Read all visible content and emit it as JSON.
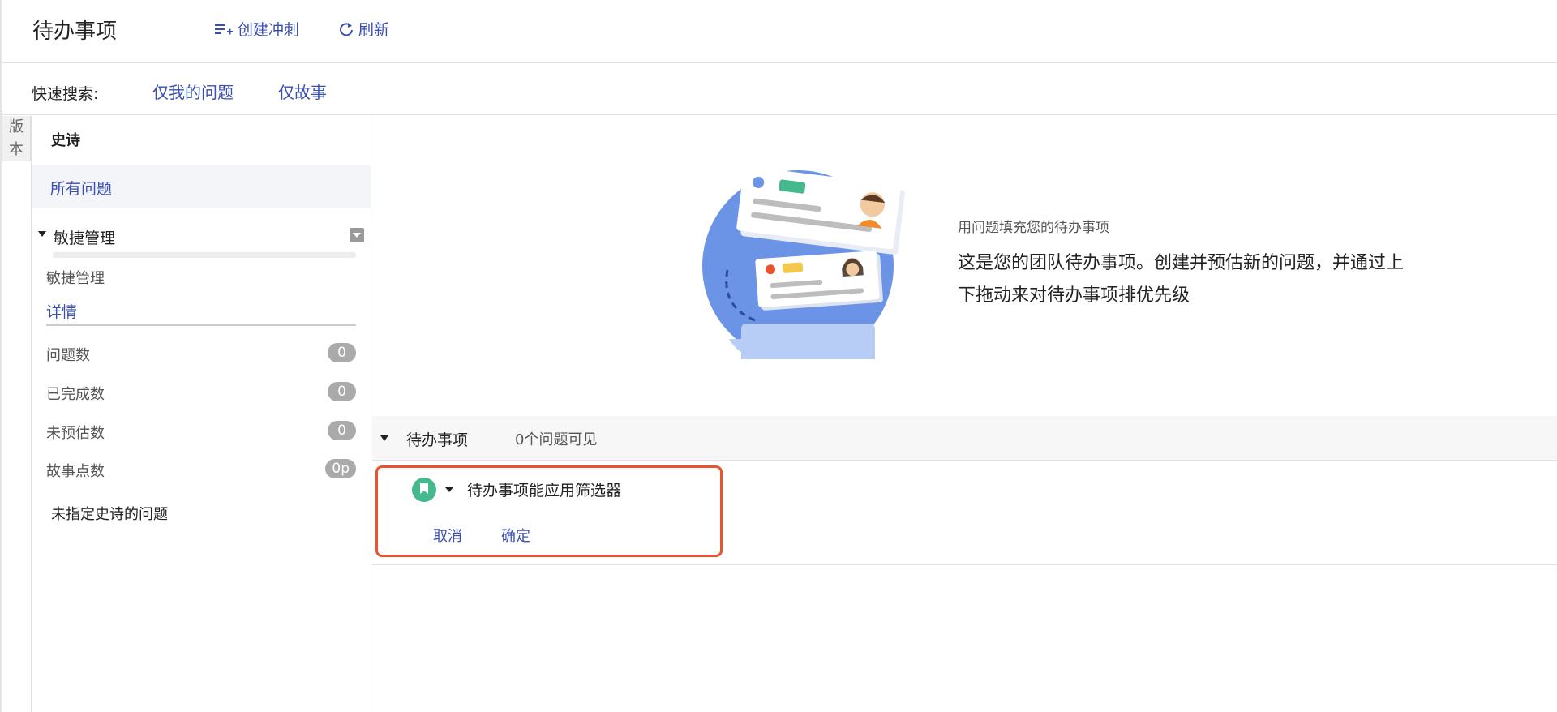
{
  "header": {
    "title": "待办事项",
    "create_sprint": "创建冲刺",
    "refresh": "刷新"
  },
  "quick_search": {
    "label": "快速搜索:",
    "only_my_issues": "仅我的问题",
    "only_stories": "仅故事"
  },
  "version_tab": {
    "label_1": "版",
    "label_2": "本"
  },
  "epics": {
    "header": "史诗",
    "all_issues": "所有问题",
    "item": {
      "name": "敏捷管理",
      "subname": "敏捷管理",
      "detail_link": "详情",
      "stats": [
        {
          "label": "问题数",
          "value": "0"
        },
        {
          "label": "已完成数",
          "value": "0"
        },
        {
          "label": "未预估数",
          "value": "0"
        },
        {
          "label": "故事点数",
          "value": "0p"
        }
      ]
    },
    "no_epic": "未指定史诗的问题"
  },
  "empty_state": {
    "title": "用问题填充您的待办事项",
    "description": "这是您的团队待办事项。创建并预估新的问题，并通过上下拖动来对待办事项排优先级"
  },
  "backlog": {
    "title": "待办事项",
    "count": "0个问题可见",
    "create": {
      "summary_value": "待办事项能应用筛选器",
      "cancel": "取消",
      "confirm": "确定"
    }
  },
  "colors": {
    "link": "#3b4fb0",
    "highlight_border": "#e8542d",
    "story_icon": "#45b88e"
  }
}
